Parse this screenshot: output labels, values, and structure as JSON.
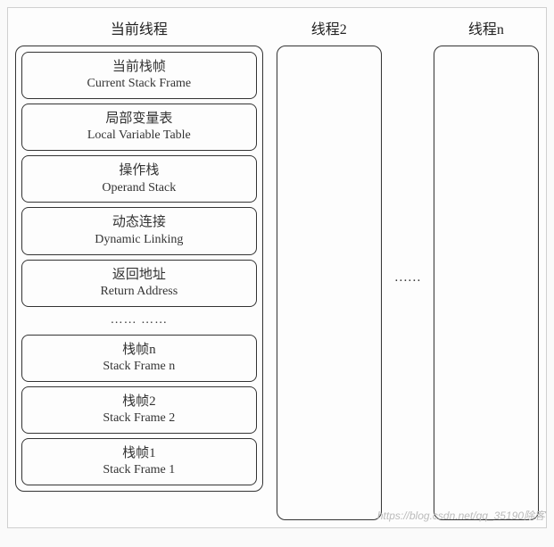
{
  "columns": {
    "current": {
      "title": "当前线程"
    },
    "thread2": {
      "title": "线程2"
    },
    "threadn": {
      "title": "线程n"
    }
  },
  "current_frame": {
    "header": {
      "cn": "当前栈帧",
      "en": "Current Stack Frame"
    },
    "parts": [
      {
        "cn": "局部变量表",
        "en": "Local Variable Table"
      },
      {
        "cn": "操作栈",
        "en": "Operand Stack"
      },
      {
        "cn": "动态连接",
        "en": "Dynamic Linking"
      },
      {
        "cn": "返回地址",
        "en": "Return Address"
      }
    ],
    "parts_ellipsis": "……  ……"
  },
  "other_frames": [
    {
      "cn": "栈帧n",
      "en": "Stack Frame n"
    },
    {
      "cn": "栈帧2",
      "en": "Stack Frame 2"
    },
    {
      "cn": "栈帧1",
      "en": "Stack Frame 1"
    }
  ],
  "mid_ellipsis": "……",
  "watermark": "https://blog.csdn.net/qq_35190除客"
}
